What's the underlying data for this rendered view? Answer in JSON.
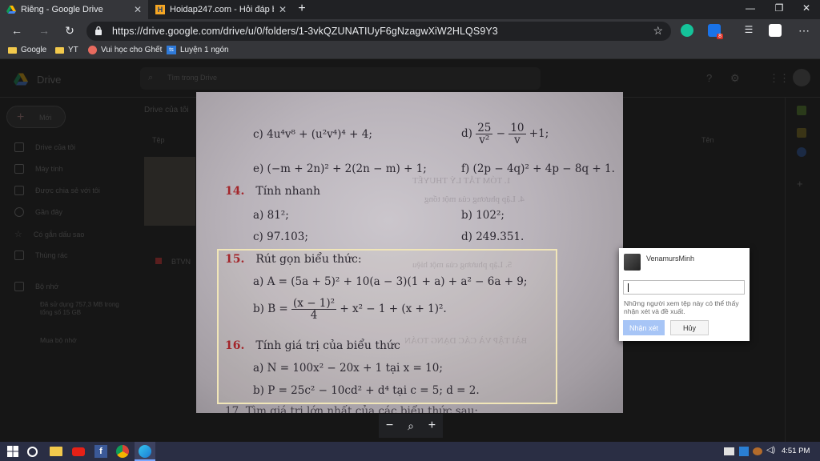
{
  "browser": {
    "tabs": [
      {
        "title": "Riêng - Google Drive",
        "active": true
      },
      {
        "title": "Hoidap247.com - Hỏi đáp bài tậ",
        "active": false
      }
    ],
    "url": "https://drive.google.com/drive/u/0/folders/1-3vkQZUNATIUyF6gNzagwXiW2HLQS9Y3",
    "bookmarks": [
      "Google",
      "YT",
      "Vui học cho Ghết",
      "Luyện 1 ngón"
    ],
    "extension_badge": "8"
  },
  "drive": {
    "logo_text": "Drive",
    "search_placeholder": "Tìm trong Drive",
    "new_button": "Mới",
    "breadcrumb": "Drive của tôi",
    "list_header": "Tệp",
    "sort_label": "Tên",
    "sidebar": [
      "Drive của tôi",
      "Máy tính",
      "Được chia sẻ với tôi",
      "Gần đây",
      "Có gắn dấu sao",
      "Thùng rác",
      "Bộ nhớ"
    ],
    "storage_text": "Đã sử dụng 757,3 MB trong tổng số 15 GB",
    "storage_link": "Mua bộ nhớ",
    "file_name": "BTVN"
  },
  "photo": {
    "lines": {
      "c_left": "c) 4u⁴v⁸ + (u²v⁴)⁴ + 4;",
      "d_right_prefix": "d)",
      "d_frac1_n": "25",
      "d_frac1_d": "v²",
      "d_frac2_n": "10",
      "d_frac2_d": "v",
      "d_right_suffix": "+1;",
      "e_left": "e) (−m + 2n)² + 2(2n − m) + 1;",
      "f_right": "f) (2p − 4q)² + 4p − 8q + 1.",
      "q14_num": "14.",
      "q14_title": "Tính nhanh",
      "q14_a": "a) 81²;",
      "q14_b": "b) 102²;",
      "q14_c": "c) 97.103;",
      "q14_d": "d) 249.351.",
      "q15_num": "15.",
      "q15_title": "Rút gọn biểu thức:",
      "q15_a": "a) A = (5a + 5)² + 10(a − 3)(1 + a) + a² − 6a + 9;",
      "q15_b_prefix": "b) B =",
      "q15_b_frac_n": "(x − 1)²",
      "q15_b_frac_d": "4",
      "q15_b_suffix": "+ x² − 1 + (x + 1)².",
      "q16_num": "16.",
      "q16_title": "Tính giá trị của biểu thức",
      "q16_a": "a) N = 100x² − 20x + 1  tại  x = 10;",
      "q16_b": "b) P = 25c² − 10cd² + d⁴  tại  c = 5; d = 2.",
      "q17_partial": "17.   Tìm giá trị lớn nhất của các biểu thức sau:"
    },
    "ghost_text": [
      "1. TÓM TẮT LÝ THUYẾT",
      "4. Lập phương của một tổng",
      "5. Lập phương của một hiệu",
      "BÀI TẬP VÀ CÁC DẠNG TOÁN"
    ],
    "zoom_controls": {
      "minus": "−",
      "zoom": "⌕",
      "plus": "+"
    }
  },
  "comment": {
    "user": "VenamursMinh",
    "note": "Những người xem tệp này có thể thấy nhận xét và đề xuất.",
    "submit": "Nhận xét",
    "cancel": "Hủy"
  },
  "taskbar": {
    "time": "4:51 PM"
  },
  "colors": {
    "accent_red": "#a3252a",
    "submit_blue": "#a7c5f6",
    "taskbar": "#2a2e44"
  }
}
